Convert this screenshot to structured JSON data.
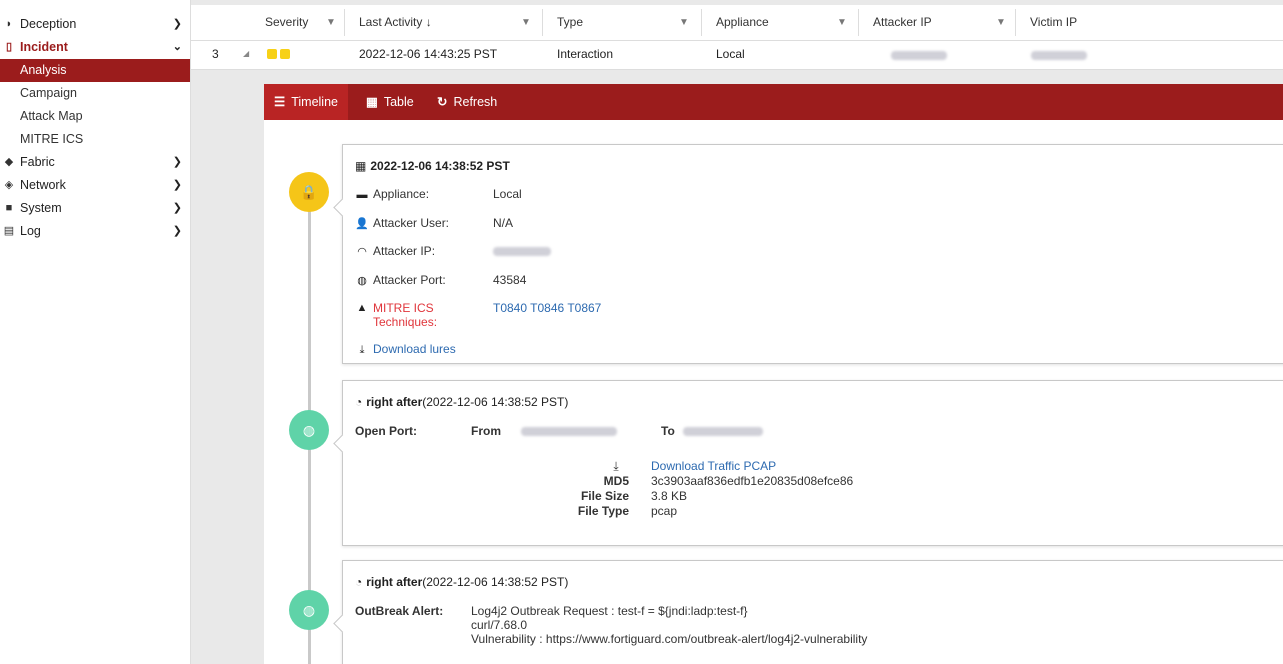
{
  "sidebar": {
    "items": [
      {
        "label": "Deception",
        "icon": "deception-icon"
      },
      {
        "label": "Incident",
        "icon": "incident-icon"
      },
      {
        "label": "Fabric",
        "icon": "fabric-icon"
      },
      {
        "label": "Network",
        "icon": "network-icon"
      },
      {
        "label": "System",
        "icon": "system-icon"
      },
      {
        "label": "Log",
        "icon": "log-icon"
      }
    ],
    "incident_sub": [
      "Analysis",
      "Campaign",
      "Attack Map",
      "MITRE ICS"
    ]
  },
  "grid": {
    "headers": {
      "severity": "Severity",
      "last_activity": "Last Activity ↓",
      "type": "Type",
      "appliance": "Appliance",
      "attacker_ip": "Attacker IP",
      "victim_ip": "Victim IP"
    },
    "row": {
      "index": "3",
      "expand": "◢",
      "last_activity": "2022-12-06 14:43:25 PST",
      "type": "Interaction",
      "appliance": "Local"
    }
  },
  "toolbar": {
    "timeline": "Timeline",
    "table": "Table",
    "refresh": "Refresh"
  },
  "events": [
    {
      "date": "2022-12-06 14:38:52 PST",
      "appliance_label": "Appliance:",
      "appliance": "Local",
      "attacker_user_label": "Attacker User:",
      "attacker_user": "N/A",
      "attacker_ip_label": "Attacker IP:",
      "attacker_port_label": "Attacker Port:",
      "attacker_port": "43584",
      "mitre_label": "MITRE ICS Techniques:",
      "techniques": [
        "T0840",
        "T0846",
        "T0867"
      ],
      "download": "Download lures"
    },
    {
      "prefix": "right after",
      "date": "(2022-12-06 14:38:52 PST)",
      "open_port_label": "Open Port:",
      "from": "From",
      "to": "To",
      "download_pcap": "Download Traffic PCAP",
      "md5_label": "MD5",
      "md5": "3c3903aaf836edfb1e20835d08efce86",
      "filesize_label": "File Size",
      "filesize": "3.8 KB",
      "filetype_label": "File Type",
      "filetype": "pcap"
    },
    {
      "prefix": "right after",
      "date": "(2022-12-06 14:38:52 PST)",
      "alert_label": "OutBreak Alert:",
      "line1": "Log4j2 Outbreak Request : test-f = ${jndi:ladp:test-f}",
      "line2": "curl/7.68.0",
      "line3": "Vulnerability : https://www.fortiguard.com/outbreak-alert/log4j2-vulnerability"
    }
  ],
  "colors": {
    "accent": "#9b1c1c",
    "severity": "#f7d117",
    "dot_yellow": "#f5c518",
    "dot_green": "#5fd3a8",
    "link": "#2d6ab0",
    "mitre": "#e0353b"
  }
}
